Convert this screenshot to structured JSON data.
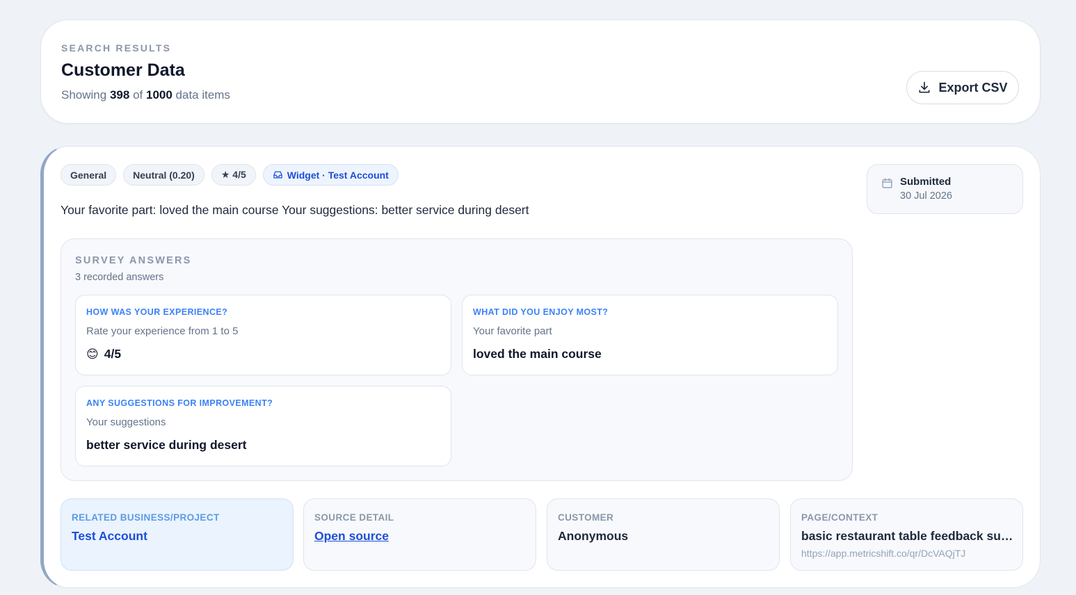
{
  "header": {
    "eyebrow": "SEARCH RESULTS",
    "title": "Customer Data",
    "showing_prefix": "Showing",
    "shown_count": "398",
    "of_text": "of",
    "total_count": "1000",
    "suffix": "data items",
    "export_label": "Export CSV",
    "export_icon": "download-icon"
  },
  "record": {
    "tags": {
      "category": "General",
      "sentiment": "Neutral (0.20)",
      "rating": "★ 4/5",
      "source": "Widget · Test Account",
      "source_icon": "inbox-icon"
    },
    "summary": "Your favorite part: loved the main course Your suggestions: better service during desert",
    "submitted": {
      "label": "Submitted",
      "date": "30 Jul 2026",
      "icon": "calendar-icon"
    },
    "survey": {
      "title": "SURVEY ANSWERS",
      "count_text": "3 recorded answers",
      "answers": [
        {
          "question": "HOW WAS YOUR EXPERIENCE?",
          "subtitle": "Rate your experience from 1 to 5",
          "emoji": "😊",
          "value": "4/5"
        },
        {
          "question": "WHAT DID YOU ENJOY MOST?",
          "subtitle": "Your favorite part",
          "value": "loved the main course"
        },
        {
          "question": "ANY SUGGESTIONS FOR IMPROVEMENT?",
          "subtitle": "Your suggestions",
          "value": "better service during desert"
        }
      ]
    },
    "info": {
      "related": {
        "label": "RELATED BUSINESS/PROJECT",
        "value": "Test Account"
      },
      "source": {
        "label": "SOURCE DETAIL",
        "value": "Open source"
      },
      "customer": {
        "label": "CUSTOMER",
        "value": "Anonymous"
      },
      "context": {
        "label": "PAGE/CONTEXT",
        "value": "basic restaurant table feedback survey",
        "url": "https://app.metricshift.co/qr/DcVAQjTJ"
      }
    }
  },
  "colors": {
    "accent": "#1d4ed8",
    "question_blue": "#3b82f6",
    "card_left_border": "#91a7c4",
    "background": "#eff3f8"
  }
}
